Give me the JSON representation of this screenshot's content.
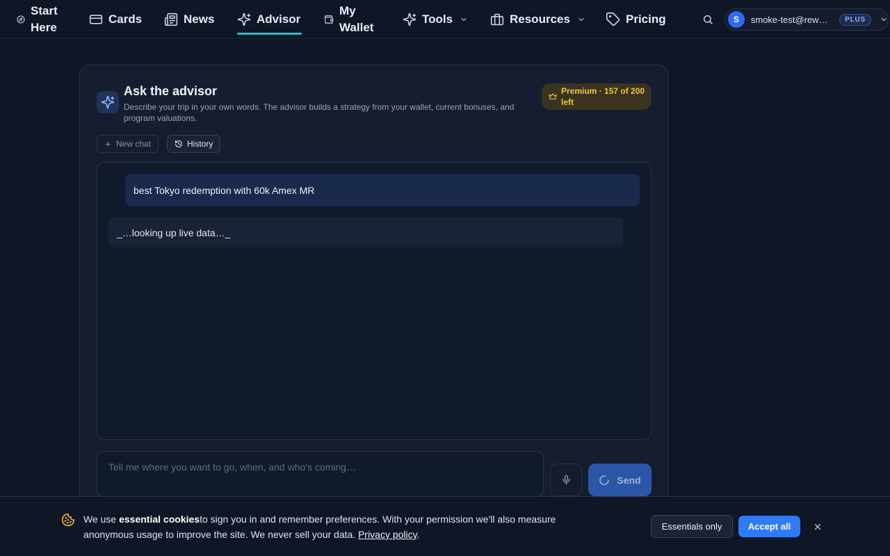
{
  "nav": {
    "start_here": "Start Here",
    "start_here_line1": "Start",
    "start_here_line2": "Here",
    "cards": "Cards",
    "news": "News",
    "advisor": "Advisor",
    "wallet_line1": "My",
    "wallet_line2": "Wallet",
    "tools": "Tools",
    "resources": "Resources",
    "pricing": "Pricing",
    "active_item": "Advisor",
    "accent_color": "#2bc0c9"
  },
  "account": {
    "avatar_letter": "S",
    "email": "smoke-test@rewar…",
    "plan_badge": "PLUS"
  },
  "advisor": {
    "title": "Ask the advisor",
    "description": "Describe your trip in your own words. The advisor builds a strategy from your wallet, current bonuses, and program valuations.",
    "premium_badge": "Premium · 157 of 200 left",
    "new_chat_label": "New chat",
    "history_label": "History",
    "messages": [
      {
        "role": "user",
        "text": "best Tokyo redemption with 60k Amex MR"
      },
      {
        "role": "assistant",
        "text": "_…looking up live data…_"
      }
    ],
    "input_placeholder": "Tell me where you want to go, when, and who's coming…",
    "send_label": "Send",
    "send_state": "loading"
  },
  "cookie_banner": {
    "text_before": "We use ",
    "text_bold": "essential cookies",
    "text_after": "to sign you in and remember preferences. With your permission we'll also measure anonymous usage to improve the site. We never sell your data. ",
    "link_text": "Privacy policy",
    "text_end": ".",
    "essentials_label": "Essentials only",
    "accept_label": "Accept all"
  },
  "icons": [
    "compass-icon",
    "credit-card-icon",
    "newspaper-icon",
    "sparkles-icon",
    "wallet-icon",
    "chevron-down-icon",
    "briefcase-icon",
    "tag-icon",
    "search-icon",
    "crown-icon",
    "plus-icon",
    "history-icon",
    "microphone-icon",
    "spinner-icon",
    "cookie-icon",
    "close-icon"
  ],
  "colors": {
    "background": "#0f1626",
    "primary": "#2f7bf5",
    "premium": "#f2c641"
  }
}
